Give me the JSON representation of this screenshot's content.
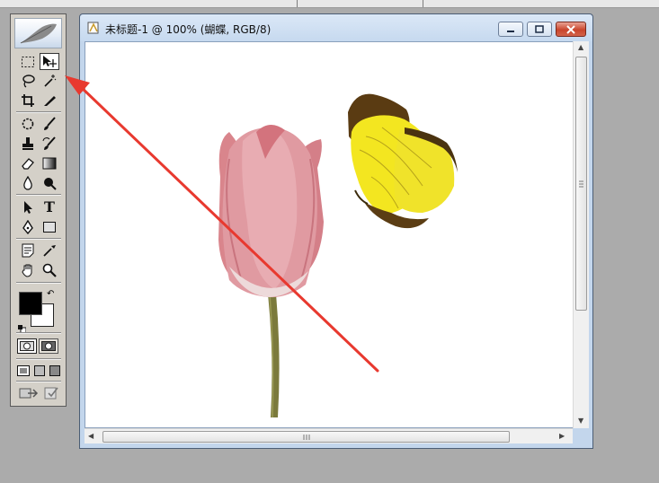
{
  "document": {
    "title": "未标题-1 @ 100% (蝴蝶, RGB/8)"
  },
  "toolbox": {
    "header_icon": "feather-icon",
    "tools": [
      "marquee-icon",
      "move-icon",
      "lasso-icon",
      "magic-wand-icon",
      "crop-icon",
      "slice-icon",
      "healing-brush-icon",
      "brush-icon",
      "clone-stamp-icon",
      "history-brush-icon",
      "eraser-icon",
      "gradient-icon",
      "blur-icon",
      "dodge-icon",
      "path-selection-icon",
      "type-icon",
      "pen-icon",
      "shape-icon",
      "notes-icon",
      "eyedropper-icon",
      "hand-icon",
      "zoom-icon"
    ],
    "selected_tool": "move-icon",
    "type_glyph": "T"
  },
  "colors": {
    "foreground": "#000000",
    "background": "#ffffff",
    "annotation_arrow": "#e8392f"
  }
}
